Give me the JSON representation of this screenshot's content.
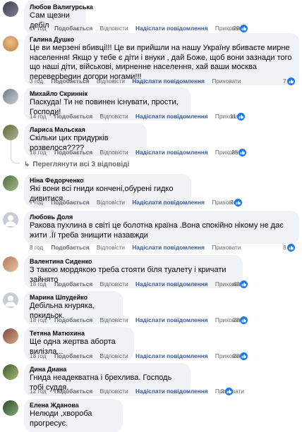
{
  "actions": {
    "like": "Подобається",
    "reply": "Відповісти",
    "send": "Надіслати повідомлення",
    "hide": "Приховати"
  },
  "view_replies": "Переглянути всі 3 відповіді",
  "comments": [
    {
      "author": "Любов Валигурська",
      "text": "Сам щезни дебіл",
      "time": "17 год",
      "likes": "29"
    },
    {
      "author": "Галина Душко",
      "text": "Це ви мерзені вбивці!!! Це ви прийшли на нашу Україну вбиваєте мирне населення! Якщо у тебе є діти і внуки , дай Боже, щоб вони зазнади того що наші діти, військові, мирненне населення, хай ваши москва переверbegин догори ногами!!!",
      "time": "3 год",
      "likes": "7"
    },
    {
      "author": "Михайло Скриннік",
      "text": "Паскуда! Ти не повинен існувати, прости, Господи!",
      "time": "14 год",
      "likes": "11"
    },
    {
      "author": "Лариса Мальская",
      "text": "Скільки цих придурків розвелося????",
      "time": "18 год",
      "likes": "25"
    },
    {
      "author": "Ніна Федорченко",
      "text": "Які вони всі гниди кончені,обурені гидко дивитися.",
      "time": "7 год",
      "likes": "7"
    },
    {
      "author": "Любовь Доля",
      "text": "Ракова пухлина в світі це болотна країна .Вона спокійно нікому не дає жити .Її треба знищити назавжди",
      "time": "8 год",
      "likes": "8"
    },
    {
      "author": "Валентина Сиденко",
      "text": "З такою мордякою треба стояти біля туалету і кричати зайнято",
      "time": "18 год",
      "likes": "43"
    },
    {
      "author": "Марина Шпудейко",
      "text": "Дебільна кнуряка, покидьок.",
      "time": "18 год",
      "likes": "28"
    },
    {
      "author": "Тетяна Матюхина",
      "text": "Ще одна жертва аборта вилізла...",
      "time": "18 год",
      "likes": "28"
    },
    {
      "author": "Дина Диана",
      "text": "Гнида неадекватна і брехлива. Господь тобі суддя.",
      "time": "12 год",
      "likes": "2"
    },
    {
      "author": "Елена Жданова",
      "text": "Нелюди ,хвороба прогресує.",
      "time": "",
      "likes": ""
    }
  ],
  "colors": {
    "bubble": "#f0f2f5",
    "link": "#385898",
    "like": "#1877f2",
    "muted": "#65676b"
  }
}
